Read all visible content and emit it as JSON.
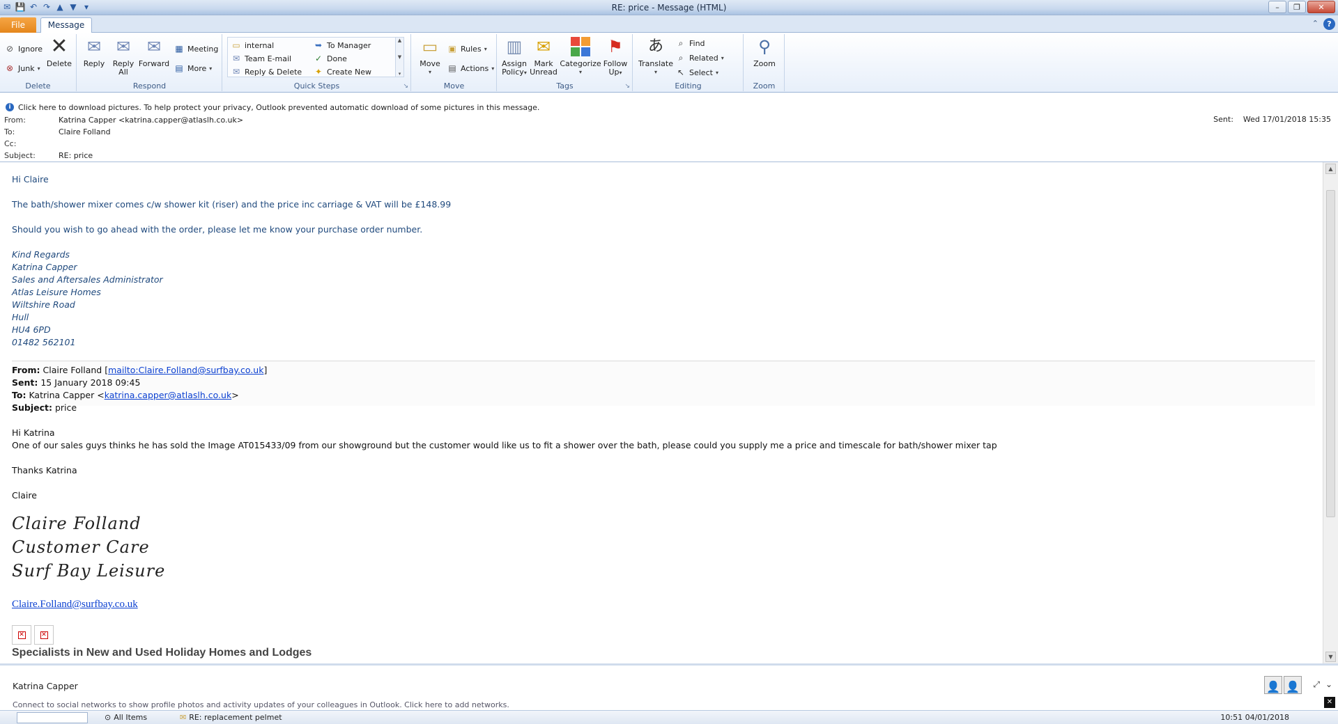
{
  "window": {
    "title": "RE: price  -  Message (HTML)",
    "controls": [
      "–",
      "❐",
      "✕"
    ]
  },
  "tabs": {
    "file": "File",
    "message": "Message",
    "collapse": "⌃",
    "help": "?"
  },
  "ribbon": {
    "delete_group": {
      "label": "Delete",
      "ignore": "Ignore",
      "junk": "Junk",
      "delete": "Delete"
    },
    "respond_group": {
      "label": "Respond",
      "reply": "Reply",
      "reply_all_1": "Reply",
      "reply_all_2": "All",
      "forward": "Forward",
      "meeting": "Meeting",
      "more": "More"
    },
    "quick_steps_group": {
      "label": "Quick Steps",
      "items": [
        "internal",
        "Team E-mail",
        "Reply & Delete",
        "To Manager",
        "Done",
        "Create New"
      ]
    },
    "move_group": {
      "label": "Move",
      "move": "Move",
      "rules": "Rules",
      "actions": "Actions"
    },
    "tags_group": {
      "label": "Tags",
      "assign_1": "Assign",
      "assign_2": "Policy",
      "mark_1": "Mark",
      "mark_2": "Unread",
      "categorize": "Categorize",
      "follow_1": "Follow",
      "follow_2": "Up"
    },
    "editing_group": {
      "label": "Editing",
      "translate": "Translate",
      "find": "Find",
      "related": "Related",
      "select": "Select"
    },
    "zoom_group": {
      "label": "Zoom",
      "zoom": "Zoom"
    }
  },
  "infobar": "Click here to download pictures. To help protect your privacy, Outlook prevented automatic download of some pictures in this message.",
  "header": {
    "from_label": "From:",
    "from_value": "Katrina Capper <katrina.capper@atlaslh.co.uk>",
    "to_label": "To:",
    "to_value": "Claire Folland",
    "cc_label": "Cc:",
    "cc_value": "",
    "subject_label": "Subject:",
    "subject_value": "RE: price",
    "sent_label": "Sent:",
    "sent_value": "Wed 17/01/2018 15:35"
  },
  "body": {
    "greeting": "Hi Claire",
    "line1": "The bath/shower mixer comes c/w shower kit (riser) and the price inc carriage & VAT will be £148.99",
    "line2": "Should you wish to go ahead with the order, please let me know your purchase order number.",
    "signature": [
      "Kind Regards",
      "Katrina Capper",
      "Sales and Aftersales Administrator",
      "Atlas Leisure Homes",
      "Wiltshire Road",
      "Hull",
      "HU4 6PD",
      "01482 562101"
    ],
    "quoted": {
      "from_label": "From:",
      "from_name": "Claire Folland [",
      "from_link": "mailto:Claire.Folland@surfbay.co.uk",
      "from_close": "]",
      "sent_label": "Sent:",
      "sent_value": "15 January 2018 09:45",
      "to_label": "To:",
      "to_name": "Katrina Capper <",
      "to_link": "katrina.capper@atlaslh.co.uk",
      "to_close": ">",
      "subject_label": "Subject:",
      "subject_value": "price",
      "greeting": "Hi Katrina",
      "text": "One of our sales guys thinks he has sold the Image AT015433/09 from our showground but the customer would like us to fit a shower over the bath, please could you supply me a price and timescale for bath/shower mixer tap",
      "thanks": "Thanks Katrina",
      "name": "Claire",
      "script_lines": [
        "Claire Folland",
        "Customer Care",
        "Surf Bay Leisure"
      ],
      "email_link": "Claire.Folland@surfbay.co.uk",
      "tagline": "Specialists in New and Used Holiday Homes and Lodges"
    }
  },
  "people_pane": {
    "name": "Katrina Capper",
    "note": "Connect to social networks to show profile photos and activity updates of your colleagues in Outlook. Click here to add networks."
  },
  "status": {
    "all_items": "All Items",
    "item_subject": "RE: replacement pelmet",
    "item_time": "10:51  04/01/2018"
  }
}
